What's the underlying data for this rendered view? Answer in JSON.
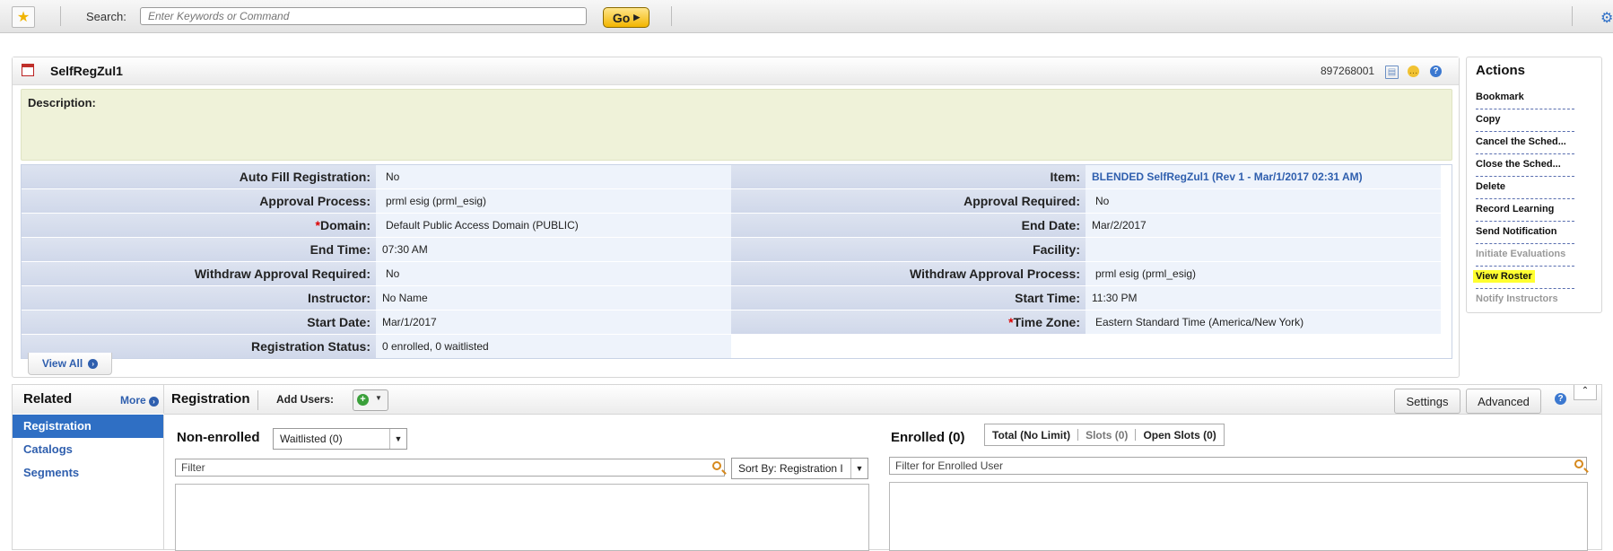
{
  "toolbar": {
    "search_label": "Search:",
    "search_placeholder": "Enter Keywords or Command",
    "go_label": "Go"
  },
  "item": {
    "title": "SelfRegZul1",
    "code": "897268001",
    "description_label": "Description:",
    "view_all": "View All"
  },
  "fields_left": [
    {
      "label": "Auto Fill Registration:",
      "value": "No"
    },
    {
      "label": "Approval Process:",
      "value": "prml esig (prml_esig)"
    },
    {
      "label": "Domain:",
      "value": "Default Public Access Domain (PUBLIC)",
      "required": true
    },
    {
      "label": "End Time:",
      "value": "07:30 AM"
    },
    {
      "label": "Withdraw Approval Required:",
      "value": "No"
    },
    {
      "label": "Instructor:",
      "value": "No Name"
    },
    {
      "label": "Start Date:",
      "value": "Mar/1/2017"
    },
    {
      "label": "Registration Status:",
      "value": "0 enrolled, 0 waitlisted"
    }
  ],
  "fields_right": [
    {
      "label": "Item:",
      "value": "BLENDED SelfRegZul1 (Rev 1 - Mar/1/2017 02:31 AM)",
      "link": true
    },
    {
      "label": "Approval Required:",
      "value": "No"
    },
    {
      "label": "End Date:",
      "value": "Mar/2/2017"
    },
    {
      "label": "Facility:",
      "value": ""
    },
    {
      "label": "Withdraw Approval Process:",
      "value": "prml esig (prml_esig)"
    },
    {
      "label": "Start Time:",
      "value": "11:30 PM"
    },
    {
      "label": "Time Zone:",
      "value": "Eastern Standard Time (America/New York)",
      "required": true
    }
  ],
  "actions": {
    "title": "Actions",
    "items": [
      {
        "label": "Bookmark"
      },
      {
        "label": "Copy"
      },
      {
        "label": "Cancel the Sched..."
      },
      {
        "label": "Close the Sched..."
      },
      {
        "label": "Delete"
      },
      {
        "label": "Record Learning"
      },
      {
        "label": "Send Notification"
      },
      {
        "label": "Initiate Evaluations",
        "disabled": true
      },
      {
        "label": "View Roster",
        "highlighted": true
      },
      {
        "label": "Notify Instructors",
        "disabled": true
      }
    ]
  },
  "related": {
    "title": "Related",
    "more": "More",
    "items": [
      "Registration",
      "Catalogs",
      "Segments"
    ]
  },
  "registration": {
    "title": "Registration",
    "add_users": "Add Users:",
    "settings": "Settings",
    "advanced": "Advanced",
    "non_enrolled_title": "Non-enrolled",
    "waitlisted_select": "Waitlisted (0)",
    "filter_placeholder": "Filter",
    "sort_select": "Sort By: Registration I",
    "enrolled_title": "Enrolled (0)",
    "tabs": [
      "Total (No Limit)",
      "Slots (0)",
      "Open Slots (0)"
    ],
    "enrolled_filter_placeholder": "Filter for Enrolled User"
  }
}
